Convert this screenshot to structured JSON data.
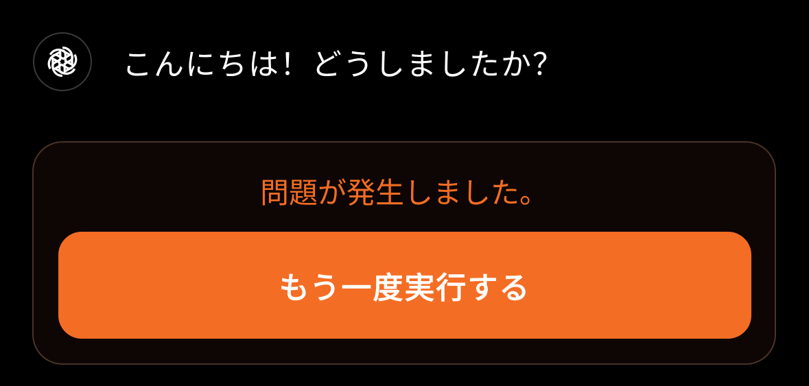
{
  "assistant": {
    "avatar_icon": "openai-logo-icon",
    "message": "こんにちは！どうしましたか？"
  },
  "error": {
    "message": "問題が発生しました。",
    "retry_label": "もう一度実行する"
  },
  "colors": {
    "background": "#000000",
    "accent": "#f46d24",
    "error_text": "#f26d24",
    "card_background": "#0e0604",
    "card_border": "#4a3428"
  }
}
